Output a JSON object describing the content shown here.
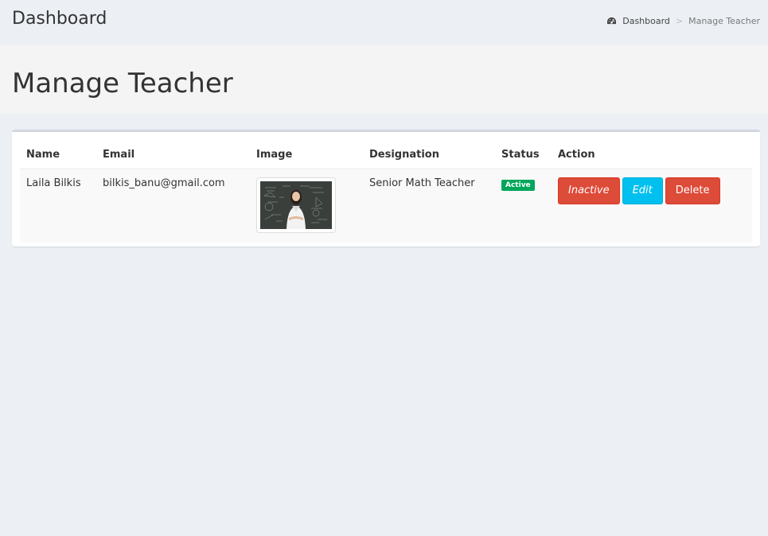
{
  "topbar": {
    "title": "Dashboard",
    "breadcrumb": {
      "home_label": "Dashboard",
      "home_icon": "dashboard-icon",
      "separator": ">",
      "current": "Manage Teacher"
    }
  },
  "page": {
    "heading": "Manage Teacher"
  },
  "table": {
    "headers": [
      "Name",
      "Email",
      "Image",
      "Designation",
      "Status",
      "Action"
    ],
    "rows": [
      {
        "name": "Laila Bilkis",
        "email": "bilkis_banu@gmail.com",
        "image": "teacher-photo",
        "designation": "Senior Math Teacher",
        "status": "Active",
        "actions": {
          "inactive": "Inactive",
          "edit": "Edit",
          "delete": "Delete"
        }
      }
    ]
  },
  "colors": {
    "background": "#ecf0f5",
    "status_active": "#00a65a",
    "danger": "#dd4b39",
    "info": "#00c0ef"
  }
}
